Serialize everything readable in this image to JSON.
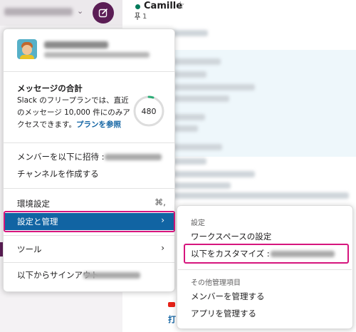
{
  "sidebar": {
    "workspace_name": "happychime-ourlcom",
    "chevron": "⌄",
    "compose_icon": "compose-icon"
  },
  "header": {
    "channel_name": "Camille",
    "star_icon": "☆",
    "pin_count": "1"
  },
  "account_menu": {
    "workspace_title": "happychime-ourlcom",
    "workspace_url": "happychime-ourlcom.slack.com",
    "usage": {
      "title": "メッセージの合計",
      "desc_before": "Slack のフリープランでは、直近のメッセージ 10,000 件にのみアクセスできます。",
      "link": "プランを参照",
      "count": "480",
      "progress": 0.048
    },
    "invite_label": "メンバーを以下に招待 : ",
    "invite_workspace": "happychime-our...",
    "create_channel": "チャンネルを作成する",
    "preferences": "環境設定",
    "preferences_shortcut": "⌘,",
    "settings_admin": "設定と管理",
    "tools": "ツール",
    "sign_out": "以下からサインアウト",
    "sign_out_workspace": "happychime-ourlcom"
  },
  "settings_submenu": {
    "settings_header": "設定",
    "workspace_settings": "ワークスペースの設定",
    "customize_label": "以下をカスタマイズ : ",
    "customize_workspace": "happychime-ourl...",
    "other_admin_header": "その他管理項目",
    "manage_members": "メンバーを管理する",
    "manage_apps": "アプリを管理する"
  },
  "chat_fragment": {
    "bottom_text": "打"
  },
  "colors": {
    "aubergine": "#5b1d55",
    "active_blue": "#1164a3",
    "highlight_pink": "#d6157d",
    "presence_green": "#007a5a",
    "progress_green": "#2bac76"
  }
}
